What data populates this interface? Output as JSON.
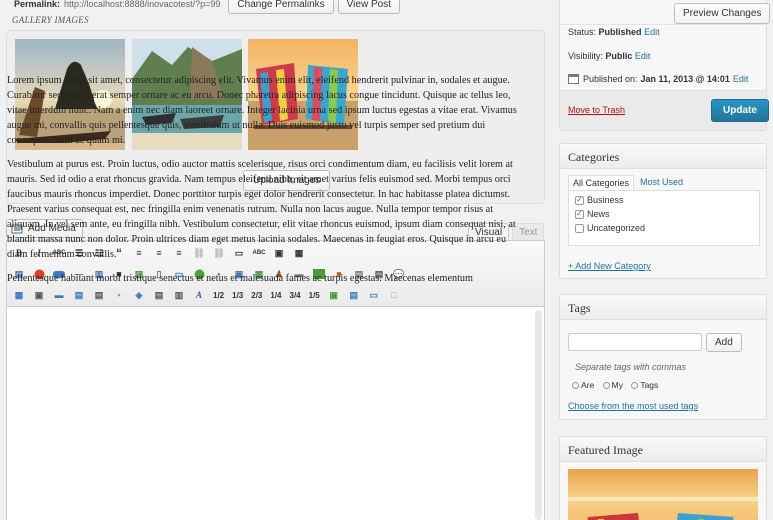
{
  "permalink": {
    "label": "Permalink:",
    "url": "http://localhost:8888/inovacotest/?p=99",
    "change_btn": "Change Permalinks",
    "view_btn": "View Post"
  },
  "gallery": {
    "title": "GALLERY IMAGES",
    "upload_label": "Upload Images"
  },
  "editor": {
    "add_media_label": "Add Media",
    "tab_visual": "Visual",
    "tab_text": "Text",
    "frac_buttons": [
      "1/2",
      "1/3",
      "2/3",
      "1/4",
      "3/4",
      "1/5"
    ],
    "paragraphs": [
      "Lorem ipsum dolor sit amet, consectetur adipiscing elit. Vivamus enim elit, eleifend hendrerit pulvinar in, sodales et augue. Curabitur sed felis a erat semper ornare ac eu arcu. Donec pharetra adipiscing lacus congue tincidunt. Quisque ac tellus leo, vitae interdum nunc. Nam a enim nec diam laoreet ornare. Integer lacinia urna sed ipsum luctus egestas a vitae erat. Vivamus augue mi, convallis quis pellentesque quis, vestibulum ut nulla. Duis euismod justo vel turpis semper sed pretium dui consequat. Nam ac quam mi.",
      "Vestibulum at purus est. Proin luctus, odio auctor mattis scelerisque, risus orci condimentum diam, eu facilisis velit lorem at mauris. Sed id odio a erat rhoncus gravida. Nam tempus eleifend nibh, sit amet varius felis euismod sed. Morbi tempus orci faucibus mauris rhoncus imperdiet. Donec porttitor turpis eget dolor hendrerit consectetur. In hac habitasse platea dictumst. Praesent varius consequat est, nec fringilla enim venenatis rutrum. Nulla non lacus augue. Nulla tempor tempor risus at aliquam. In vel sem ante, eu fringilla nibh. Vestibulum consectetur, elit vitae rhoncus euismod, ipsum diam consequat nisi, at blandit massa nunc non dolor. Proin ultrices diam eget metus lacinia sodales. Maecenas in feugiat eros. Quisque in arcu eu diam fermentum convallis.",
      "Pellentesque habitant morbi tristique senectus et netus et malesuada fames ac turpis egestas. Maecenas elementum"
    ]
  },
  "publish": {
    "preview_label": "Preview Changes",
    "status_label": "Status:",
    "status_value": "Published",
    "status_edit": "Edit",
    "visibility_label": "Visibility:",
    "visibility_value": "Public",
    "visibility_edit": "Edit",
    "published_label": "Published on:",
    "published_value": "Jan 11, 2013 @ 14:01",
    "published_edit": "Edit",
    "trash_label": "Move to Trash",
    "update_label": "Update"
  },
  "categories": {
    "title": "Categories",
    "tab_all": "All Categories",
    "tab_used": "Most Used",
    "items": [
      {
        "label": "Business",
        "checked": true
      },
      {
        "label": "News",
        "checked": true
      },
      {
        "label": "Uncategorized",
        "checked": false
      }
    ],
    "add_new": "+ Add New Category"
  },
  "tags": {
    "title": "Tags",
    "add_label": "Add",
    "hint": "Separate tags with commas",
    "items": [
      "Are",
      "My",
      "Tags"
    ],
    "choose_link": "Choose from the most used tags"
  },
  "featured": {
    "title": "Featured Image"
  },
  "colors": {
    "accent": "#21759b",
    "trash": "#bc0b0b"
  }
}
